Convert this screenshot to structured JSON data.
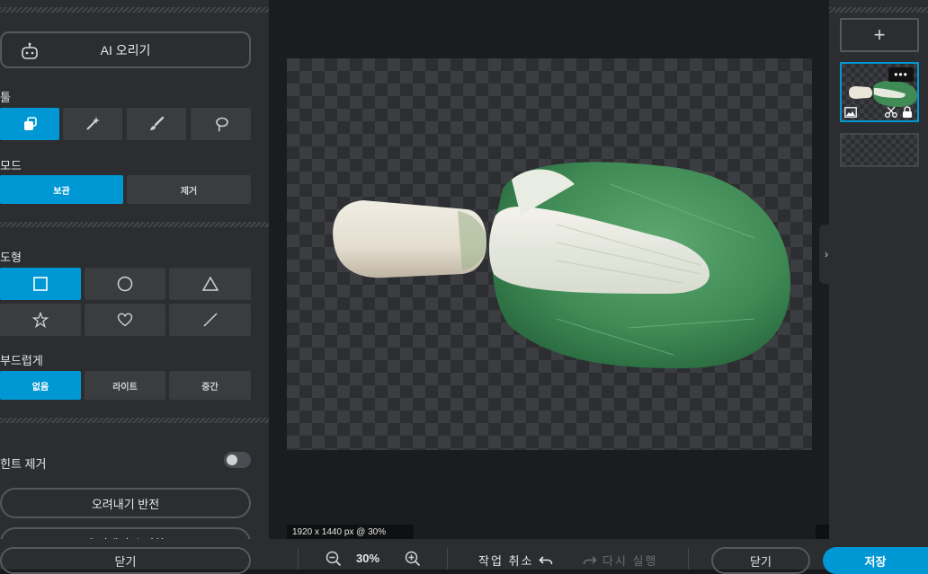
{
  "left_panel": {
    "ai_cutout_label": "AI 오리기",
    "tools_label": "툴",
    "mode_label": "모드",
    "mode_options": [
      "보관",
      "제거"
    ],
    "shape_label": "도형",
    "feather_label": "부드럽게",
    "feather_options": [
      "없음",
      "라이트",
      "중간"
    ],
    "hint_remove_label": "힌트 제거",
    "hint_remove_on": false,
    "invert_label": "오려내기 반전",
    "init_label": "오려내기 초기화",
    "close_label": "닫기"
  },
  "canvas": {
    "size_label": "1920 x 1440 px @ 30%"
  },
  "right_panel": {
    "add_label": "+",
    "more_label": "•••",
    "collapse_label": "›"
  },
  "bottom": {
    "zoom_value": "30%",
    "undo_label": "작업 취소",
    "redo_label": "다시 실행",
    "close_label": "닫기",
    "save_label": "저장"
  },
  "colors": {
    "accent": "#0098d4",
    "panel": "#2b2d30",
    "canvas_bg": "#1b1c1e"
  },
  "icons": {
    "ai": "robot-icon",
    "tools": [
      "eraser-icon",
      "magic-wand-icon",
      "brush-icon",
      "lasso-icon"
    ],
    "shapes": [
      "square-icon",
      "circle-icon",
      "triangle-icon",
      "star-icon",
      "heart-icon",
      "line-icon"
    ]
  }
}
